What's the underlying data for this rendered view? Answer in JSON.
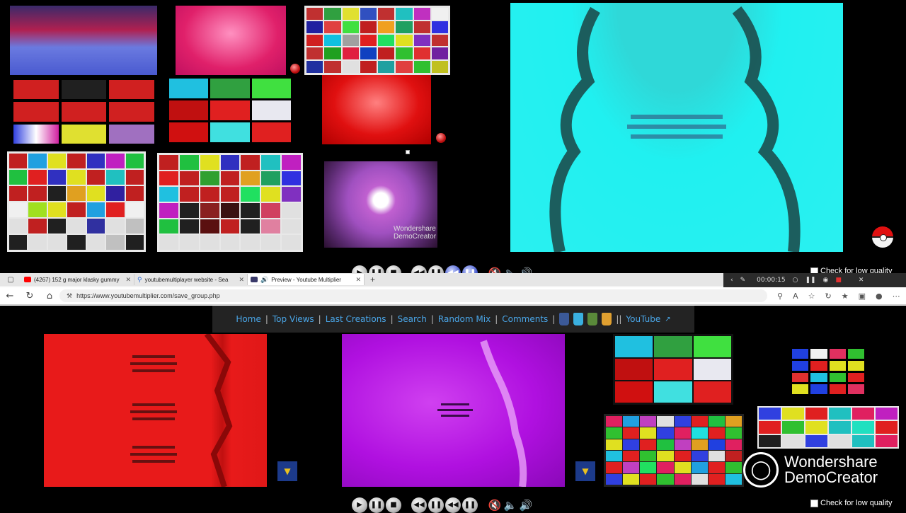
{
  "top_controls": {
    "low_quality_label": "Check for low quality"
  },
  "browser": {
    "tabs": [
      {
        "title": "(4267) 152 g major klasky gummy",
        "favicon": "youtube-icon",
        "color": "#ff0000"
      },
      {
        "title": "youtubemultiplayer website - Sea",
        "favicon": "search-icon",
        "color": "#2a6bd6"
      },
      {
        "title": "Preview - Youtube Multiplier",
        "favicon": "site-icon",
        "color": "#3a3a6a",
        "active": true
      }
    ],
    "new_tab_label": "+",
    "url": "https://www.youtubemultiplier.com/save_group.php",
    "recorder": {
      "time": "00:00:15"
    }
  },
  "site_nav": {
    "links": [
      "Home",
      "Top Views",
      "Last Creations",
      "Search",
      "Random Mix",
      "Comments"
    ],
    "youtube_label": "YouTube"
  },
  "bottom_controls": {
    "low_quality_label": "Check for low quality"
  },
  "watermark": {
    "line1": "Wondershare",
    "line2": "DemoCreator"
  }
}
